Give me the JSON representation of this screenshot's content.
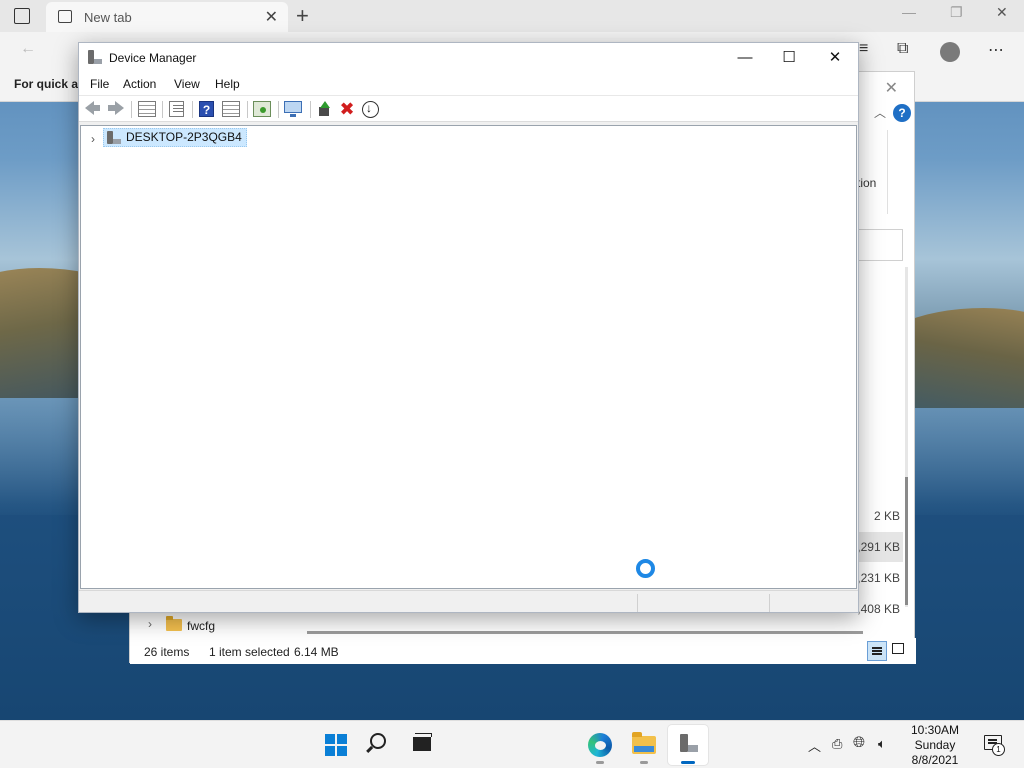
{
  "browser": {
    "tab_title": "New tab",
    "quick_access_text": "For quick ac"
  },
  "explorer": {
    "ribbon_fragment": "tion",
    "sizes": [
      "2 KB",
      ",291 KB",
      ",231 KB",
      ",408 KB"
    ],
    "folder_name": "fwcfg",
    "status": {
      "items_count": "26 items",
      "selection": "1 item selected",
      "selection_size": "6.14 MB"
    }
  },
  "device_manager": {
    "title": "Device Manager",
    "menu": [
      "File",
      "Action",
      "View",
      "Help"
    ],
    "toolbar": {
      "help_glyph": "?",
      "remove_glyph": "✖"
    },
    "tree": {
      "root_label": "DESKTOP-2P3QGB4"
    },
    "window_buttons": {
      "minimize": "—",
      "maximize": "☐",
      "close": "✕"
    }
  },
  "taskbar": {
    "clock": {
      "time": "10:30AM",
      "day": "Sunday",
      "date": "8/8/2021"
    },
    "notification_count": "1",
    "accent_color": "#0067c0"
  }
}
